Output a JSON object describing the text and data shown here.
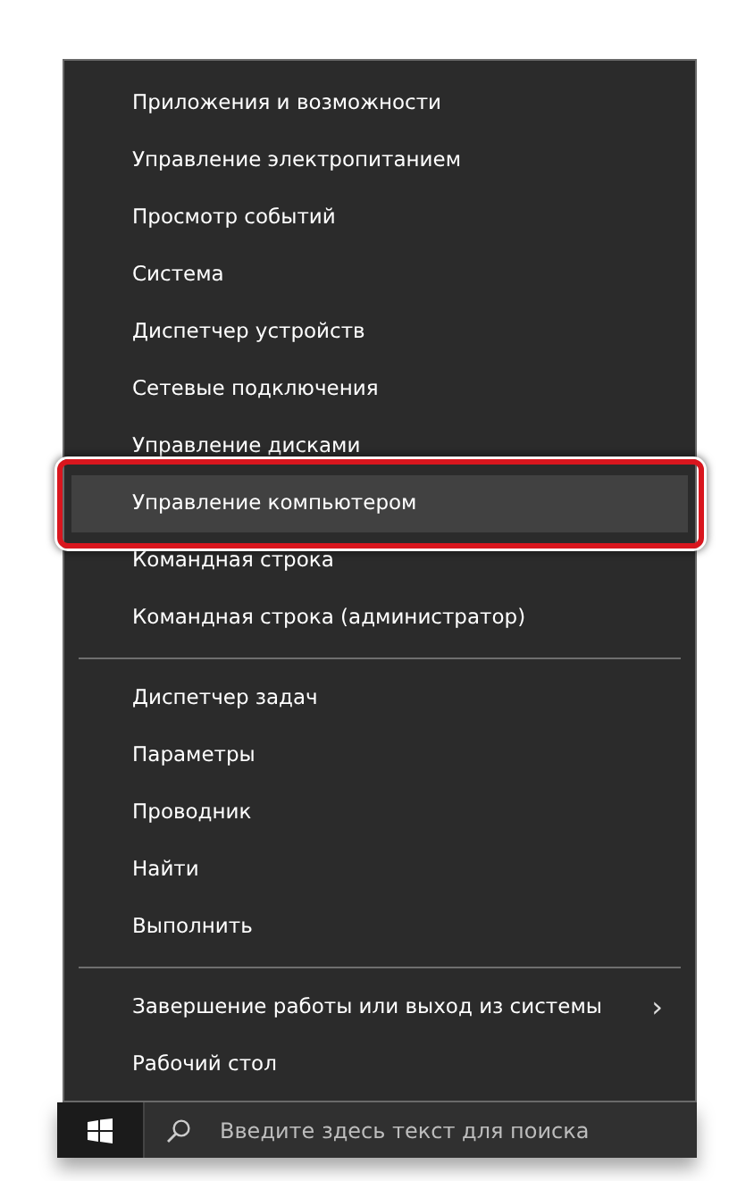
{
  "menu": {
    "groups": [
      {
        "items": [
          {
            "label": "Приложения и возможности",
            "selected": false,
            "highlighted": false,
            "submenu": false
          },
          {
            "label": "Управление электропитанием",
            "selected": false,
            "highlighted": false,
            "submenu": false
          },
          {
            "label": "Просмотр событий",
            "selected": false,
            "highlighted": false,
            "submenu": false
          },
          {
            "label": "Система",
            "selected": false,
            "highlighted": false,
            "submenu": false
          },
          {
            "label": "Диспетчер устройств",
            "selected": false,
            "highlighted": false,
            "submenu": false
          },
          {
            "label": "Сетевые подключения",
            "selected": false,
            "highlighted": false,
            "submenu": false
          },
          {
            "label": "Управление дисками",
            "selected": false,
            "highlighted": false,
            "submenu": false
          },
          {
            "label": "Управление компьютером",
            "selected": true,
            "highlighted": true,
            "submenu": false
          },
          {
            "label": "Командная строка",
            "selected": false,
            "highlighted": false,
            "submenu": false
          },
          {
            "label": "Командная строка (администратор)",
            "selected": false,
            "highlighted": false,
            "submenu": false
          }
        ]
      },
      {
        "items": [
          {
            "label": "Диспетчер задач",
            "selected": false,
            "highlighted": false,
            "submenu": false
          },
          {
            "label": "Параметры",
            "selected": false,
            "highlighted": false,
            "submenu": false
          },
          {
            "label": "Проводник",
            "selected": false,
            "highlighted": false,
            "submenu": false
          },
          {
            "label": "Найти",
            "selected": false,
            "highlighted": false,
            "submenu": false
          },
          {
            "label": "Выполнить",
            "selected": false,
            "highlighted": false,
            "submenu": false
          }
        ]
      },
      {
        "items": [
          {
            "label": "Завершение работы или выход из системы",
            "selected": false,
            "highlighted": false,
            "submenu": true,
            "arrow": "›"
          },
          {
            "label": "Рабочий стол",
            "selected": false,
            "highlighted": false,
            "submenu": false
          }
        ]
      }
    ]
  },
  "taskbar": {
    "search": {
      "placeholder": "Введите здесь текст для поиска"
    }
  }
}
